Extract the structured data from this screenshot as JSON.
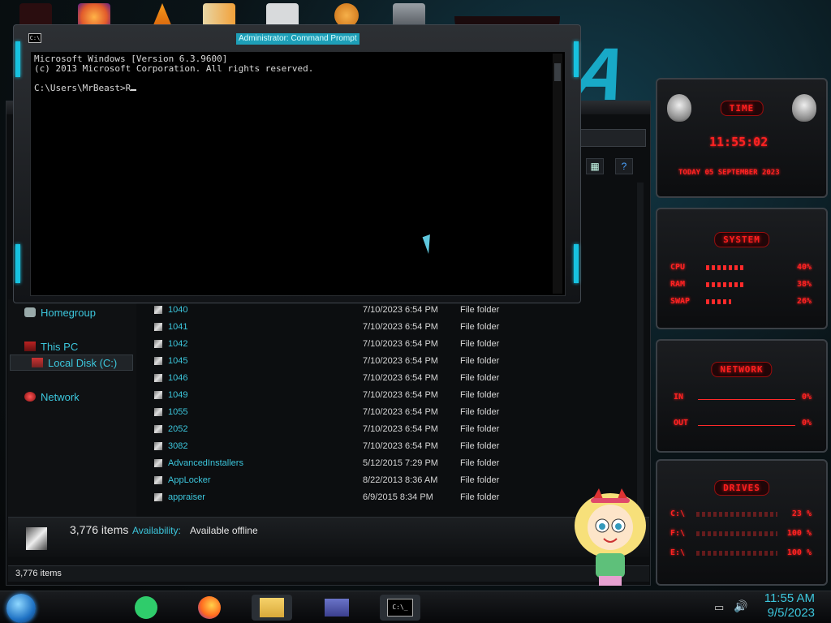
{
  "cmd": {
    "title": "Administrator: Command Prompt",
    "icon_text": "C:\\",
    "lines": [
      "Microsoft Windows [Version 6.3.9600]",
      "(c) 2013 Microsoft Corporation. All rights reserved.",
      "",
      "C:\\Users\\MrBeast>R"
    ]
  },
  "explorer": {
    "nav": {
      "homegroup": "Homegroup",
      "this_pc": "This PC",
      "local_disk": "Local Disk (C:)",
      "network": "Network"
    },
    "files": [
      {
        "name": "1040",
        "date": "7/10/2023 6:54 PM",
        "type": "File folder"
      },
      {
        "name": "1041",
        "date": "7/10/2023 6:54 PM",
        "type": "File folder"
      },
      {
        "name": "1042",
        "date": "7/10/2023 6:54 PM",
        "type": "File folder"
      },
      {
        "name": "1045",
        "date": "7/10/2023 6:54 PM",
        "type": "File folder"
      },
      {
        "name": "1046",
        "date": "7/10/2023 6:54 PM",
        "type": "File folder"
      },
      {
        "name": "1049",
        "date": "7/10/2023 6:54 PM",
        "type": "File folder"
      },
      {
        "name": "1055",
        "date": "7/10/2023 6:54 PM",
        "type": "File folder"
      },
      {
        "name": "2052",
        "date": "7/10/2023 6:54 PM",
        "type": "File folder"
      },
      {
        "name": "3082",
        "date": "7/10/2023 6:54 PM",
        "type": "File folder"
      },
      {
        "name": "AdvancedInstallers",
        "date": "5/12/2015 7:29 PM",
        "type": "File folder"
      },
      {
        "name": "AppLocker",
        "date": "8/22/2013 8:36 AM",
        "type": "File folder"
      },
      {
        "name": "appraiser",
        "date": "6/9/2015 8:34 PM",
        "type": "File folder"
      }
    ],
    "details": {
      "count": "3,776 items",
      "availability_label": "Availability:",
      "availability_value": "Available offline"
    },
    "status_count": "3,776 items"
  },
  "gadgets": {
    "time": {
      "title": "TIME",
      "clock": "11:55:02",
      "date": "TODAY 05 SEPTEMBER 2023"
    },
    "system": {
      "title": "SYSTEM",
      "rows": [
        {
          "label": "CPU",
          "value": "40%",
          "fill": 0.4
        },
        {
          "label": "RAM",
          "value": "38%",
          "fill": 0.38
        },
        {
          "label": "SWAP",
          "value": "26%",
          "fill": 0.26
        }
      ]
    },
    "network": {
      "title": "NETWORK",
      "rows": [
        {
          "label": "IN",
          "value": "0%"
        },
        {
          "label": "OUT",
          "value": "0%"
        }
      ]
    },
    "drives": {
      "title": "DRIVES",
      "rows": [
        {
          "label": "C:\\",
          "value": "23 %"
        },
        {
          "label": "F:\\",
          "value": "100 %"
        },
        {
          "label": "E:\\",
          "value": "100 %"
        }
      ]
    }
  },
  "taskbar": {
    "time": "11:55 AM",
    "date": "9/5/2023",
    "cmd_icon_text": "C:\\_"
  },
  "colors": {
    "accent": "#17c2e0",
    "link": "#3cc6dc",
    "gadget_red": "#ff2222"
  }
}
